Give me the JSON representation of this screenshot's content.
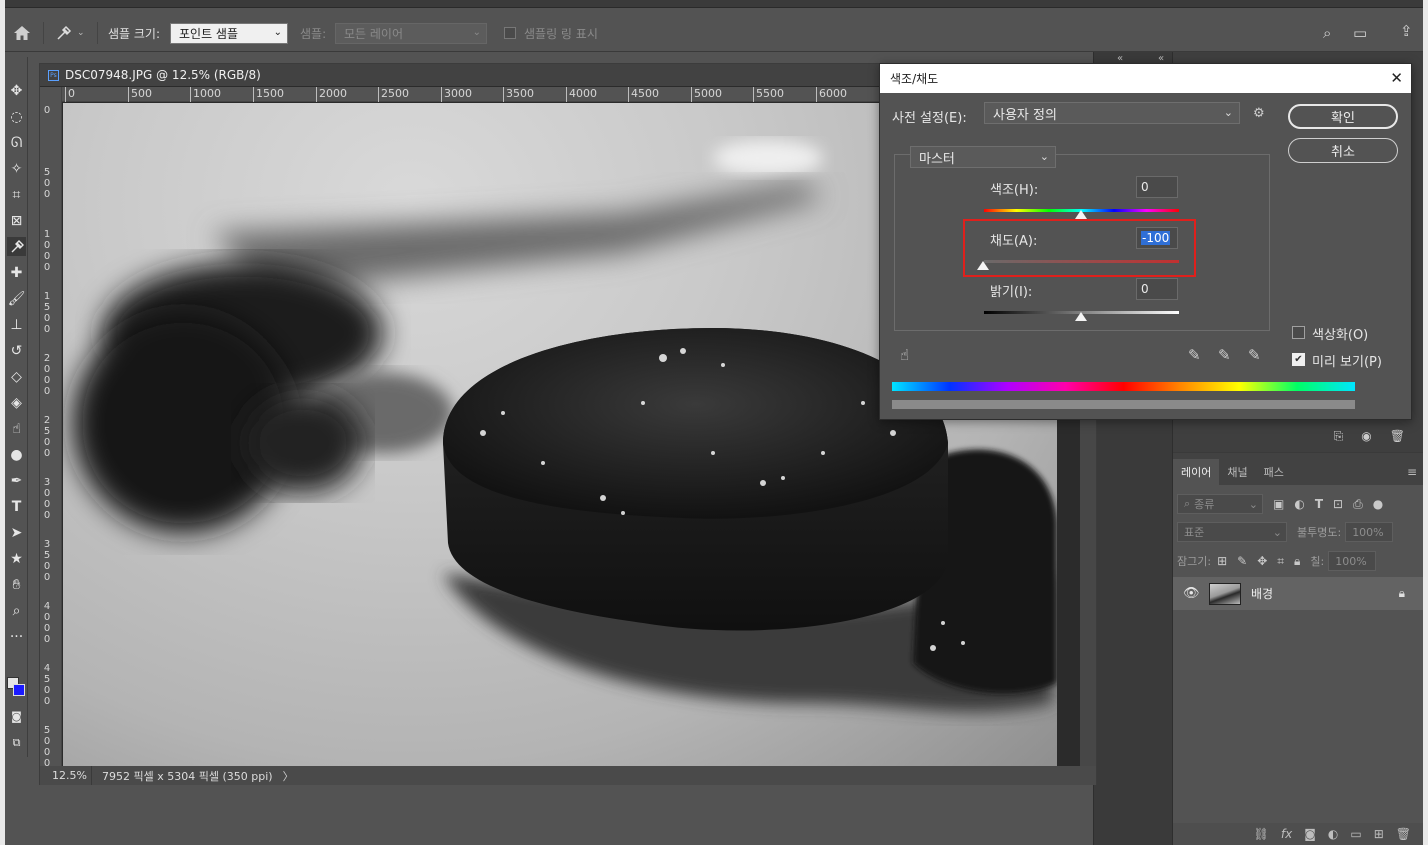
{
  "options_bar": {
    "sample_size_label": "샘플 크기:",
    "sample_size_value": "포인트 샘플",
    "sample_label": "샘플:",
    "sample_value": "모든 레이어",
    "show_sampling_ring": "샘플링 링 표시"
  },
  "document": {
    "tab_title": "DSC07948.JPG @ 12.5% (RGB/8)",
    "ruler_top": [
      "0",
      "500",
      "1000",
      "1500",
      "2000",
      "2500",
      "3000",
      "3500",
      "4000",
      "4500",
      "5000",
      "5500",
      "6000"
    ],
    "ruler_left": [
      "0",
      "500",
      "1000",
      "1500",
      "2000",
      "2500",
      "3000",
      "3500",
      "4000",
      "4500",
      "5000"
    ],
    "zoom": "12.5%",
    "info": "7952 픽셀 x 5304 픽셀 (350 ppi)",
    "status_arrow": "〉"
  },
  "dialog": {
    "title": "색조/채도",
    "preset_label": "사전 설정(E):",
    "preset_value": "사용자 정의",
    "ok": "확인",
    "cancel": "취소",
    "channel": "마스터",
    "hue_label": "색조(H):",
    "hue_value": "0",
    "saturation_label": "채도(A):",
    "saturation_value": "-100",
    "lightness_label": "밝기(I):",
    "lightness_value": "0",
    "colorize_label": "색상화(O)",
    "colorize_checked": false,
    "preview_label": "미리 보기(P)",
    "preview_checked": true,
    "hue_level": 0,
    "saturation_level": -100,
    "lightness_level": 0,
    "highlight_color": "#e0201c"
  },
  "layers_panel": {
    "tabs": [
      "레이어",
      "채널",
      "패스"
    ],
    "filter_kind": "종류",
    "blend_mode": "표준",
    "opacity_label": "불투명도:",
    "opacity_value": "100%",
    "lock_label": "잠그기:",
    "fill_label": "칠:",
    "fill_value": "100%",
    "layers": [
      {
        "name": "배경",
        "visible": true,
        "locked": true
      }
    ]
  }
}
